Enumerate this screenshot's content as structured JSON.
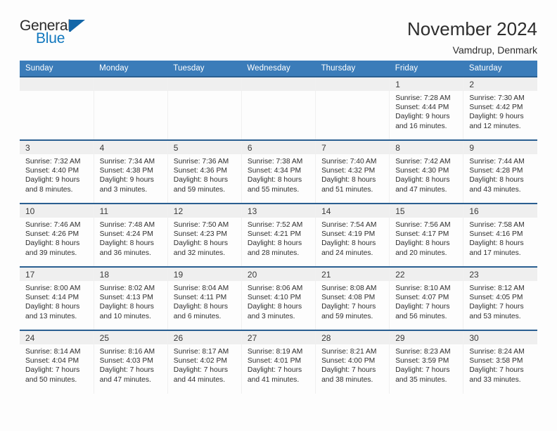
{
  "brand": {
    "name_part1": "General",
    "name_part2": "Blue",
    "flag_icon": "blue-flag-triangle",
    "accent_color": "#1278be",
    "flag_color": "#1366a8"
  },
  "header": {
    "title": "November 2024",
    "subtitle": "Vamdrup, Denmark"
  },
  "calendar": {
    "header_bg": "#3b7cb9",
    "row_divider_color": "#2a5f91",
    "daynum_strip_bg": "#efefef",
    "weekday_headers": [
      "Sunday",
      "Monday",
      "Tuesday",
      "Wednesday",
      "Thursday",
      "Friday",
      "Saturday"
    ],
    "weeks": [
      [
        {
          "day": "",
          "empty": true
        },
        {
          "day": "",
          "empty": true
        },
        {
          "day": "",
          "empty": true
        },
        {
          "day": "",
          "empty": true
        },
        {
          "day": "",
          "empty": true
        },
        {
          "day": "1",
          "sunrise": "Sunrise: 7:28 AM",
          "sunset": "Sunset: 4:44 PM",
          "daylight_line1": "Daylight: 9 hours",
          "daylight_line2": "and 16 minutes."
        },
        {
          "day": "2",
          "sunrise": "Sunrise: 7:30 AM",
          "sunset": "Sunset: 4:42 PM",
          "daylight_line1": "Daylight: 9 hours",
          "daylight_line2": "and 12 minutes."
        }
      ],
      [
        {
          "day": "3",
          "sunrise": "Sunrise: 7:32 AM",
          "sunset": "Sunset: 4:40 PM",
          "daylight_line1": "Daylight: 9 hours",
          "daylight_line2": "and 8 minutes."
        },
        {
          "day": "4",
          "sunrise": "Sunrise: 7:34 AM",
          "sunset": "Sunset: 4:38 PM",
          "daylight_line1": "Daylight: 9 hours",
          "daylight_line2": "and 3 minutes."
        },
        {
          "day": "5",
          "sunrise": "Sunrise: 7:36 AM",
          "sunset": "Sunset: 4:36 PM",
          "daylight_line1": "Daylight: 8 hours",
          "daylight_line2": "and 59 minutes."
        },
        {
          "day": "6",
          "sunrise": "Sunrise: 7:38 AM",
          "sunset": "Sunset: 4:34 PM",
          "daylight_line1": "Daylight: 8 hours",
          "daylight_line2": "and 55 minutes."
        },
        {
          "day": "7",
          "sunrise": "Sunrise: 7:40 AM",
          "sunset": "Sunset: 4:32 PM",
          "daylight_line1": "Daylight: 8 hours",
          "daylight_line2": "and 51 minutes."
        },
        {
          "day": "8",
          "sunrise": "Sunrise: 7:42 AM",
          "sunset": "Sunset: 4:30 PM",
          "daylight_line1": "Daylight: 8 hours",
          "daylight_line2": "and 47 minutes."
        },
        {
          "day": "9",
          "sunrise": "Sunrise: 7:44 AM",
          "sunset": "Sunset: 4:28 PM",
          "daylight_line1": "Daylight: 8 hours",
          "daylight_line2": "and 43 minutes."
        }
      ],
      [
        {
          "day": "10",
          "sunrise": "Sunrise: 7:46 AM",
          "sunset": "Sunset: 4:26 PM",
          "daylight_line1": "Daylight: 8 hours",
          "daylight_line2": "and 39 minutes."
        },
        {
          "day": "11",
          "sunrise": "Sunrise: 7:48 AM",
          "sunset": "Sunset: 4:24 PM",
          "daylight_line1": "Daylight: 8 hours",
          "daylight_line2": "and 36 minutes."
        },
        {
          "day": "12",
          "sunrise": "Sunrise: 7:50 AM",
          "sunset": "Sunset: 4:23 PM",
          "daylight_line1": "Daylight: 8 hours",
          "daylight_line2": "and 32 minutes."
        },
        {
          "day": "13",
          "sunrise": "Sunrise: 7:52 AM",
          "sunset": "Sunset: 4:21 PM",
          "daylight_line1": "Daylight: 8 hours",
          "daylight_line2": "and 28 minutes."
        },
        {
          "day": "14",
          "sunrise": "Sunrise: 7:54 AM",
          "sunset": "Sunset: 4:19 PM",
          "daylight_line1": "Daylight: 8 hours",
          "daylight_line2": "and 24 minutes."
        },
        {
          "day": "15",
          "sunrise": "Sunrise: 7:56 AM",
          "sunset": "Sunset: 4:17 PM",
          "daylight_line1": "Daylight: 8 hours",
          "daylight_line2": "and 20 minutes."
        },
        {
          "day": "16",
          "sunrise": "Sunrise: 7:58 AM",
          "sunset": "Sunset: 4:16 PM",
          "daylight_line1": "Daylight: 8 hours",
          "daylight_line2": "and 17 minutes."
        }
      ],
      [
        {
          "day": "17",
          "sunrise": "Sunrise: 8:00 AM",
          "sunset": "Sunset: 4:14 PM",
          "daylight_line1": "Daylight: 8 hours",
          "daylight_line2": "and 13 minutes."
        },
        {
          "day": "18",
          "sunrise": "Sunrise: 8:02 AM",
          "sunset": "Sunset: 4:13 PM",
          "daylight_line1": "Daylight: 8 hours",
          "daylight_line2": "and 10 minutes."
        },
        {
          "day": "19",
          "sunrise": "Sunrise: 8:04 AM",
          "sunset": "Sunset: 4:11 PM",
          "daylight_line1": "Daylight: 8 hours",
          "daylight_line2": "and 6 minutes."
        },
        {
          "day": "20",
          "sunrise": "Sunrise: 8:06 AM",
          "sunset": "Sunset: 4:10 PM",
          "daylight_line1": "Daylight: 8 hours",
          "daylight_line2": "and 3 minutes."
        },
        {
          "day": "21",
          "sunrise": "Sunrise: 8:08 AM",
          "sunset": "Sunset: 4:08 PM",
          "daylight_line1": "Daylight: 7 hours",
          "daylight_line2": "and 59 minutes."
        },
        {
          "day": "22",
          "sunrise": "Sunrise: 8:10 AM",
          "sunset": "Sunset: 4:07 PM",
          "daylight_line1": "Daylight: 7 hours",
          "daylight_line2": "and 56 minutes."
        },
        {
          "day": "23",
          "sunrise": "Sunrise: 8:12 AM",
          "sunset": "Sunset: 4:05 PM",
          "daylight_line1": "Daylight: 7 hours",
          "daylight_line2": "and 53 minutes."
        }
      ],
      [
        {
          "day": "24",
          "sunrise": "Sunrise: 8:14 AM",
          "sunset": "Sunset: 4:04 PM",
          "daylight_line1": "Daylight: 7 hours",
          "daylight_line2": "and 50 minutes."
        },
        {
          "day": "25",
          "sunrise": "Sunrise: 8:16 AM",
          "sunset": "Sunset: 4:03 PM",
          "daylight_line1": "Daylight: 7 hours",
          "daylight_line2": "and 47 minutes."
        },
        {
          "day": "26",
          "sunrise": "Sunrise: 8:17 AM",
          "sunset": "Sunset: 4:02 PM",
          "daylight_line1": "Daylight: 7 hours",
          "daylight_line2": "and 44 minutes."
        },
        {
          "day": "27",
          "sunrise": "Sunrise: 8:19 AM",
          "sunset": "Sunset: 4:01 PM",
          "daylight_line1": "Daylight: 7 hours",
          "daylight_line2": "and 41 minutes."
        },
        {
          "day": "28",
          "sunrise": "Sunrise: 8:21 AM",
          "sunset": "Sunset: 4:00 PM",
          "daylight_line1": "Daylight: 7 hours",
          "daylight_line2": "and 38 minutes."
        },
        {
          "day": "29",
          "sunrise": "Sunrise: 8:23 AM",
          "sunset": "Sunset: 3:59 PM",
          "daylight_line1": "Daylight: 7 hours",
          "daylight_line2": "and 35 minutes."
        },
        {
          "day": "30",
          "sunrise": "Sunrise: 8:24 AM",
          "sunset": "Sunset: 3:58 PM",
          "daylight_line1": "Daylight: 7 hours",
          "daylight_line2": "and 33 minutes."
        }
      ]
    ]
  }
}
